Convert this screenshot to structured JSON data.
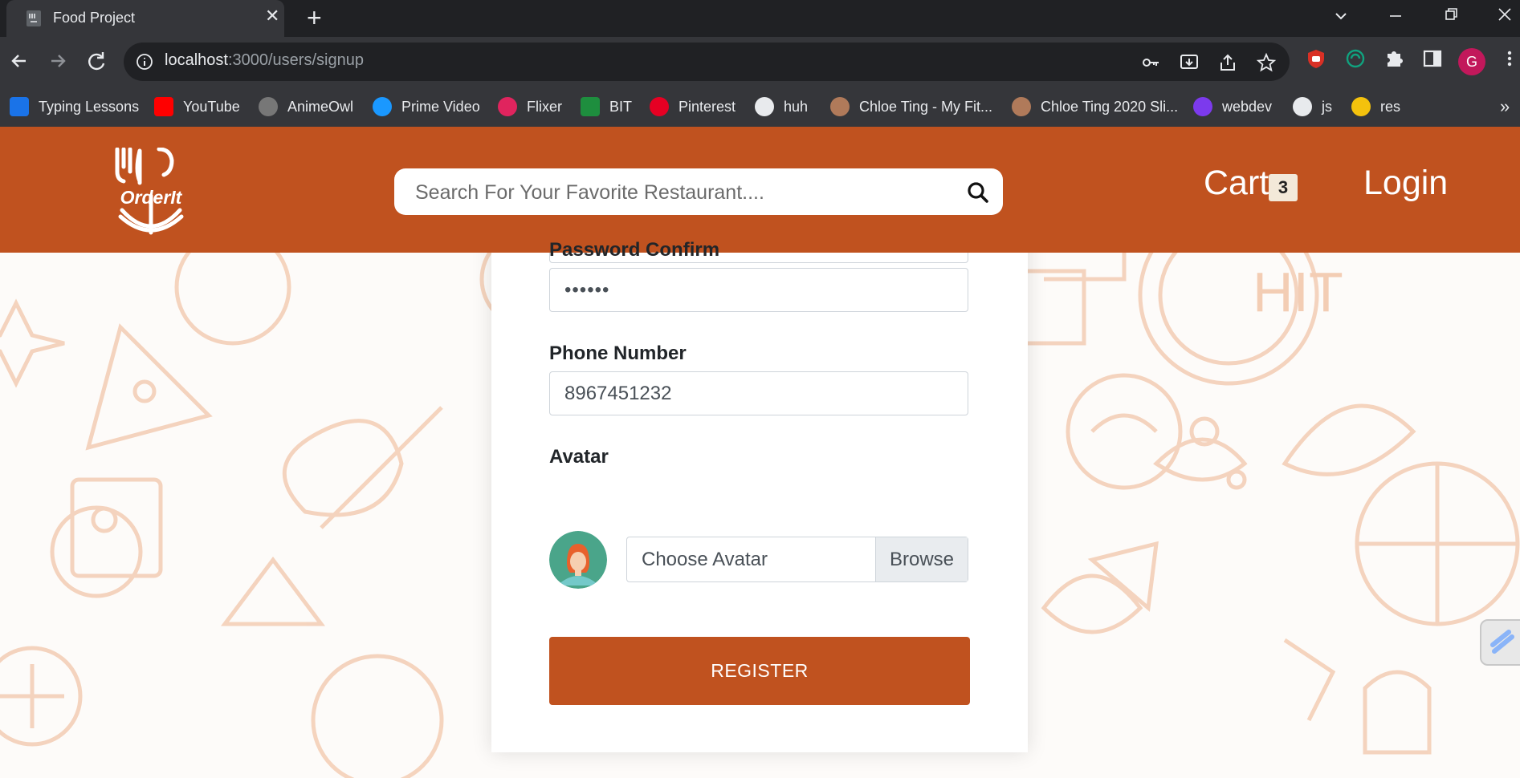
{
  "browser": {
    "tab_title": "Food Project",
    "tab_close": "✕",
    "new_tab": "+",
    "url_host": "localhost",
    "url_path": ":3000/users/signup",
    "profile_initial": "G",
    "bookmarks_more": "»",
    "bookmarks": [
      {
        "label": "Typing Lessons",
        "icon": "typing-icon",
        "color": "#1a73e8"
      },
      {
        "label": "YouTube",
        "icon": "youtube-icon",
        "color": "#ff0000"
      },
      {
        "label": "AnimeOwl",
        "icon": "animeowl-icon",
        "color": "#777777"
      },
      {
        "label": "Prime Video",
        "icon": "prime-video-icon",
        "color": "#1a98ff"
      },
      {
        "label": "Flixer",
        "icon": "flixer-icon",
        "color": "#e0245e"
      },
      {
        "label": "BIT",
        "icon": "bit-icon",
        "color": "#1e8e3e"
      },
      {
        "label": "Pinterest",
        "icon": "pinterest-icon",
        "color": "#e60023"
      },
      {
        "label": "huh",
        "icon": "github-icon",
        "color": "#e8eaed"
      },
      {
        "label": "Chloe Ting - My Fit...",
        "icon": "chloe-ting-icon",
        "color": "#b07a5a"
      },
      {
        "label": "Chloe Ting 2020 Sli...",
        "icon": "chloe-ting-icon",
        "color": "#b07a5a"
      },
      {
        "label": "webdev",
        "icon": "webdev-icon",
        "color": "#7c3aed"
      },
      {
        "label": "js",
        "icon": "github-icon",
        "color": "#e8eaed"
      },
      {
        "label": "res",
        "icon": "res-icon",
        "color": "#f4c20d"
      }
    ]
  },
  "header": {
    "logo_text": "OrderIt",
    "search_placeholder": "Search For Your Favorite Restaurant....",
    "cart_label": "Cart",
    "cart_count": "3",
    "login_label": "Login",
    "brand_color": "#c0521f"
  },
  "form": {
    "password_confirm_label": "Password Confirm",
    "password_confirm_value": "••••••",
    "phone_label": "Phone Number",
    "phone_value": "8967451232",
    "avatar_label": "Avatar",
    "avatar_file_label": "Choose Avatar",
    "browse_label": "Browse",
    "register_label": "REGISTER"
  }
}
